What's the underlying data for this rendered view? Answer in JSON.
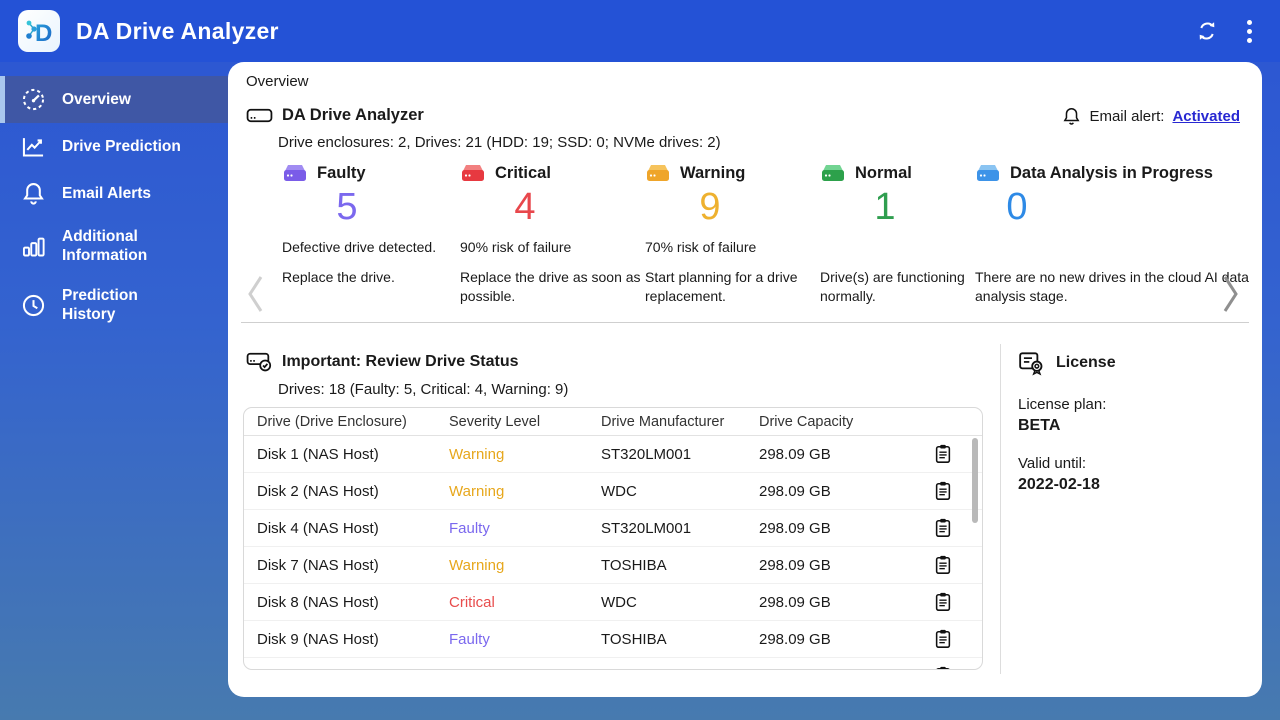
{
  "header": {
    "title": "DA Drive Analyzer"
  },
  "sidebar": {
    "items": [
      {
        "label": "Overview",
        "icon": "gauge-icon",
        "active": true
      },
      {
        "label": "Drive Prediction",
        "icon": "line-chart-icon",
        "active": false
      },
      {
        "label": "Email Alerts",
        "icon": "bell-icon",
        "active": false
      },
      {
        "label": "Additional Information",
        "icon": "bar-chart-icon",
        "active": false
      },
      {
        "label": "Prediction History",
        "icon": "clock-icon",
        "active": false
      }
    ]
  },
  "overview": {
    "breadcrumb": "Overview",
    "section_title": "DA Drive Analyzer",
    "section_subtitle": "Drive enclosures: 2, Drives: 21 (HDD: 19; SSD: 0; NVMe drives: 2)",
    "email_alert_label": "Email alert:",
    "email_alert_status": "Activated",
    "cards": [
      {
        "label": "Faulty",
        "count": 5,
        "desc": "Defective drive detected.",
        "action": "Replace the drive.",
        "color": "#7b68ee"
      },
      {
        "label": "Critical",
        "count": 4,
        "desc": "90% risk of failure",
        "action": "Replace the drive as soon as possible.",
        "color": "#e8474c"
      },
      {
        "label": "Warning",
        "count": 9,
        "desc": "70% risk of failure",
        "action": "Start planning for a drive replacement.",
        "color": "#eeb12f"
      },
      {
        "label": "Normal",
        "count": 1,
        "desc": "",
        "action": "Drive(s) are functioning normally.",
        "color": "#2f9e4f"
      },
      {
        "label": "Data Analysis in Progress",
        "count": 0,
        "desc": "",
        "action": "There are no new drives in the cloud AI data analysis stage.",
        "color": "#2e8ae6"
      }
    ]
  },
  "review": {
    "title": "Important: Review Drive Status",
    "subtitle": "Drives: 18 (Faulty: 5, Critical: 4, Warning: 9)",
    "table": {
      "headers": [
        "Drive (Drive Enclosure)",
        "Severity Level",
        "Drive Manufacturer",
        "Drive Capacity"
      ],
      "rows": [
        {
          "drive": "Disk 1 (NAS Host)",
          "severity": "Warning",
          "manufacturer": "ST320LM001",
          "capacity": "298.09 GB"
        },
        {
          "drive": "Disk 2 (NAS Host)",
          "severity": "Warning",
          "manufacturer": "WDC",
          "capacity": "298.09 GB"
        },
        {
          "drive": "Disk 4 (NAS Host)",
          "severity": "Faulty",
          "manufacturer": "ST320LM001",
          "capacity": "298.09 GB"
        },
        {
          "drive": "Disk 7 (NAS Host)",
          "severity": "Warning",
          "manufacturer": "TOSHIBA",
          "capacity": "298.09 GB"
        },
        {
          "drive": "Disk 8 (NAS Host)",
          "severity": "Critical",
          "manufacturer": "WDC",
          "capacity": "298.09 GB"
        },
        {
          "drive": "Disk 9 (NAS Host)",
          "severity": "Faulty",
          "manufacturer": "TOSHIBA",
          "capacity": "298.09 GB"
        }
      ]
    }
  },
  "license": {
    "title": "License",
    "plan_label": "License plan:",
    "plan": "BETA",
    "valid_label": "Valid until:",
    "valid": "2022-02-18"
  },
  "colors": {
    "topbar": "#2452d6",
    "sidebar_active": "#3f57a5",
    "faulty": "#7b68ee",
    "critical": "#e8474c",
    "warning": "#e7a71c",
    "normal": "#2f9e4f",
    "analysis": "#2e8ae6",
    "link": "#2828d2"
  },
  "icons": {
    "topbar": [
      "refresh-icon",
      "kebab-menu-icon"
    ],
    "sections": [
      "drive-icon",
      "bell-icon",
      "drive-check-icon",
      "license-certificate-icon",
      "clipboard-icon"
    ],
    "carousel": [
      "chevron-left-icon",
      "chevron-right-icon"
    ]
  }
}
